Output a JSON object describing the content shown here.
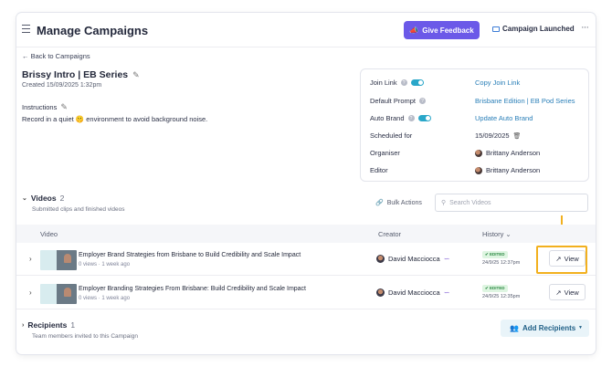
{
  "header": {
    "title": "Manage Campaigns",
    "feedback_label": "Give Feedback",
    "status_label": "Campaign Launched",
    "more_label": "···"
  },
  "back_label": "← Back to Campaigns",
  "campaign": {
    "name": "Brissy Intro | EB Series",
    "created": "Created 15/09/2025 1:32pm",
    "instructions_label": "Instructions",
    "instructions_text_before": "Record in a quiet",
    "instructions_emoji": "🤫",
    "instructions_text_after": "environment to avoid background noise."
  },
  "details": {
    "join_link_label": "Join Link",
    "join_link_value": "Copy Join Link",
    "default_prompt_label": "Default Prompt",
    "default_prompt_value": "Brisbane Edition | EB Pod Series",
    "auto_brand_label": "Auto Brand",
    "auto_brand_value": "Update Auto Brand",
    "scheduled_label": "Scheduled for",
    "scheduled_value": "15/09/2025",
    "organiser_label": "Organiser",
    "organiser_value": "Brittany Anderson",
    "editor_label": "Editor",
    "editor_value": "Brittany Anderson",
    "join_link_enabled": true,
    "auto_brand_enabled": true
  },
  "videos": {
    "label": "Videos",
    "count": "2",
    "subtitle": "Submitted clips and finished videos",
    "bulk_actions": "Bulk Actions",
    "search_placeholder": "Search Videos",
    "columns": {
      "video": "Video",
      "creator": "Creator",
      "history": "History ⌄"
    },
    "rows": [
      {
        "title": "Employer Brand Strategies from Brisbane to Build Credibility and Scale Impact",
        "meta": "0 views · 1 week ago",
        "creator": "David Macciocca",
        "badge": "✔ EDITED",
        "date": "24/9/25 12:37pm",
        "action": "View"
      },
      {
        "title": "Employer Branding Strategies From Brisbane: Build Credibility and Scale Impact",
        "meta": "0 views · 1 week ago",
        "creator": "David Macciocca",
        "badge": "✔ EDITED",
        "date": "24/9/25 12:35pm",
        "action": "View"
      }
    ]
  },
  "recipients": {
    "label": "Recipients",
    "count": "1",
    "subtitle": "Team members invited to this Campaign",
    "add_label": "Add Recipients"
  },
  "colors": {
    "accent": "#6b59e8",
    "link": "#2a7fb8",
    "toggle": "#2aa7c9",
    "highlight": "#f2b01e",
    "edited_badge": "#2e8b45"
  }
}
